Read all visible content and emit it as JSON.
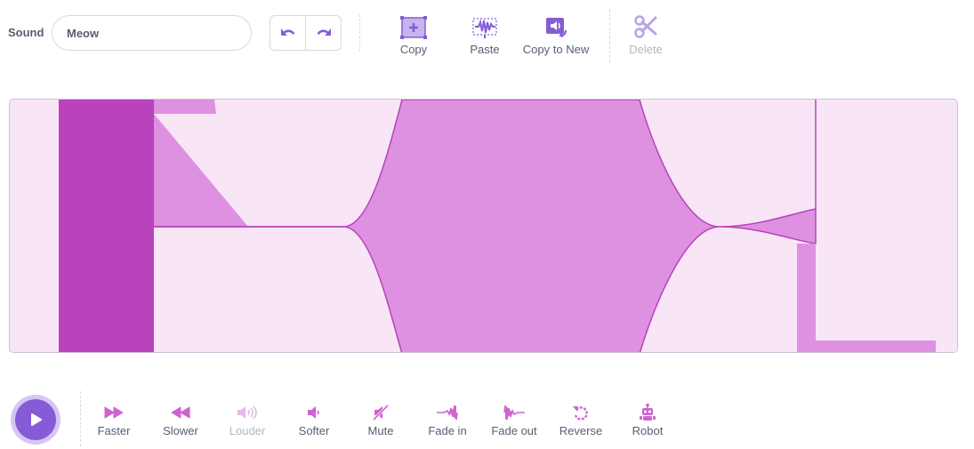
{
  "sound": {
    "label": "Sound",
    "name_value": "Meow"
  },
  "toolbar": {
    "copy": "Copy",
    "paste": "Paste",
    "copy_to_new": "Copy to New",
    "delete": "Delete"
  },
  "effects": {
    "faster": "Faster",
    "slower": "Slower",
    "louder": "Louder",
    "softer": "Softer",
    "mute": "Mute",
    "fade_in": "Fade in",
    "fade_out": "Fade out",
    "reverse": "Reverse",
    "robot": "Robot"
  },
  "colors": {
    "accent": "#855cd6",
    "effect_icon": "#cf63cf",
    "wave_fill": "#dd91e0",
    "wave_dark": "#b942bd",
    "wave_bg": "#f8e6f7"
  },
  "icons": [
    "undo-icon",
    "redo-icon",
    "copy-icon",
    "paste-icon",
    "copy-to-new-icon",
    "delete-icon",
    "play-icon",
    "faster-icon",
    "slower-icon",
    "louder-icon",
    "softer-icon",
    "mute-icon",
    "fade-in-icon",
    "fade-out-icon",
    "reverse-icon",
    "robot-icon"
  ]
}
